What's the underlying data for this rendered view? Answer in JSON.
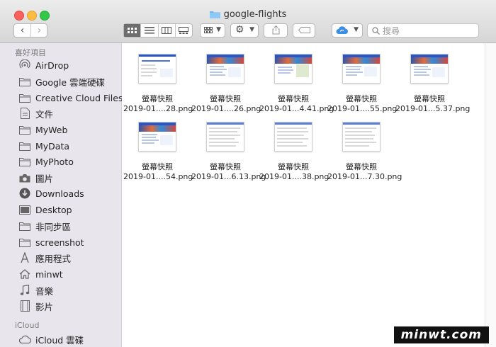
{
  "window": {
    "title": "google-flights"
  },
  "toolbar": {
    "search_placeholder": "搜尋"
  },
  "sidebar": {
    "sections": [
      {
        "label": "喜好項目",
        "items": [
          {
            "label": "AirDrop",
            "icon": "airdrop-icon"
          },
          {
            "label": "Google 雲端硬碟",
            "icon": "folder-icon"
          },
          {
            "label": "Creative Cloud Files",
            "icon": "folder-icon"
          },
          {
            "label": "文件",
            "icon": "document-icon"
          },
          {
            "label": "MyWeb",
            "icon": "folder-icon"
          },
          {
            "label": "MyData",
            "icon": "folder-icon"
          },
          {
            "label": "MyPhoto",
            "icon": "folder-icon"
          },
          {
            "label": "圖片",
            "icon": "camera-icon"
          },
          {
            "label": "Downloads",
            "icon": "download-icon"
          },
          {
            "label": "Desktop",
            "icon": "desktop-icon"
          },
          {
            "label": "非同步區",
            "icon": "folder-icon"
          },
          {
            "label": "screenshot",
            "icon": "folder-icon"
          },
          {
            "label": "應用程式",
            "icon": "applications-icon"
          },
          {
            "label": "minwt",
            "icon": "home-icon"
          },
          {
            "label": "音樂",
            "icon": "music-icon"
          },
          {
            "label": "影片",
            "icon": "movie-icon"
          }
        ]
      },
      {
        "label": "iCloud",
        "items": [
          {
            "label": "iCloud 雲碟",
            "icon": "cloud-icon"
          }
        ]
      }
    ]
  },
  "files": [
    {
      "line1": "螢幕快照",
      "line2": "2019-01....28.png",
      "thumb": "web"
    },
    {
      "line1": "螢幕快照",
      "line2": "2019-01....26.png",
      "thumb": "photo"
    },
    {
      "line1": "螢幕快照",
      "line2": "2019-01...4.41.png",
      "thumb": "map"
    },
    {
      "line1": "螢幕快照",
      "line2": "2019-01....55.png",
      "thumb": "photo"
    },
    {
      "line1": "螢幕快照",
      "line2": "2019-01...5.37.png",
      "thumb": "photo"
    },
    {
      "line1": "螢幕快照",
      "line2": "2019-01....54.png",
      "thumb": "photo"
    },
    {
      "line1": "螢幕快照",
      "line2": "2019-01...6.13.png",
      "thumb": "list"
    },
    {
      "line1": "螢幕快照",
      "line2": "2019-01....38.png",
      "thumb": "list"
    },
    {
      "line1": "螢幕快照",
      "line2": "2019-01...7.30.png",
      "thumb": "list"
    }
  ],
  "watermark": "minwt.com",
  "colors": {
    "sidebar_bg": "#e8e6ec",
    "folder_blue": "#6fb3f0",
    "active_view": "#6d6d6d"
  }
}
